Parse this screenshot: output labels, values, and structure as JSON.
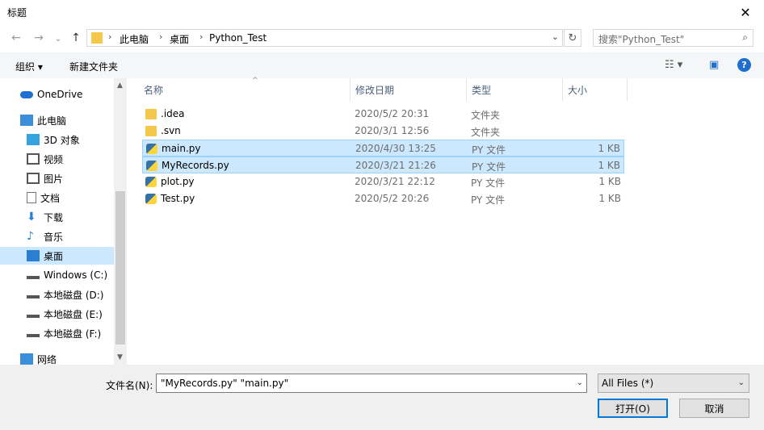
{
  "window": {
    "title": "标题",
    "close_glyph": "✕"
  },
  "nav": {
    "back_glyph": "←",
    "forward_glyph": "→",
    "recent_glyph": "⌄",
    "up_glyph": "↑",
    "breadcrumbs": [
      "此电脑",
      "桌面",
      "Python_Test"
    ],
    "sep_glyph": "›",
    "dropdown_glyph": "⌄",
    "refresh_glyph": "↻",
    "search_placeholder": "搜索\"Python_Test\"",
    "search_glyph": "⌕"
  },
  "toolbar": {
    "organize": "组织 ▾",
    "new_folder": "新建文件夹",
    "view_glyph": "☷ ▾",
    "pane_glyph": "▣",
    "help_glyph": "?"
  },
  "sidebar": {
    "items": [
      {
        "label": "OneDrive",
        "icon": "cloud-icon",
        "color": "#1e6fd0"
      },
      {
        "label": "此电脑",
        "icon": "computer-icon",
        "color": "#3a8fd8"
      },
      {
        "label": "3D 对象",
        "icon": "cube-icon",
        "color": "#35a3e0"
      },
      {
        "label": "视频",
        "icon": "video-icon",
        "color": "#555555"
      },
      {
        "label": "图片",
        "icon": "picture-icon",
        "color": "#555555"
      },
      {
        "label": "文档",
        "icon": "document-icon",
        "color": "#777777"
      },
      {
        "label": "下载",
        "icon": "download-icon",
        "color": "#2a7fd4"
      },
      {
        "label": "音乐",
        "icon": "music-icon",
        "color": "#2a7fd4"
      },
      {
        "label": "桌面",
        "icon": "desktop-icon",
        "color": "#2a7fd4",
        "selected": true
      },
      {
        "label": "Windows (C:)",
        "icon": "drive-icon",
        "color": "#555555"
      },
      {
        "label": "本地磁盘 (D:)",
        "icon": "drive-icon",
        "color": "#555555"
      },
      {
        "label": "本地磁盘 (E:)",
        "icon": "drive-icon",
        "color": "#555555"
      },
      {
        "label": "本地磁盘 (F:)",
        "icon": "drive-icon",
        "color": "#555555"
      },
      {
        "label": "网络",
        "icon": "network-icon",
        "color": "#3a8fd8"
      }
    ],
    "scroll_up": "▲",
    "scroll_down": "▼"
  },
  "list": {
    "columns": {
      "name": "名称",
      "date": "修改日期",
      "type": "类型",
      "size": "大小"
    },
    "sort_glyph": "^",
    "rows": [
      {
        "name": ".idea",
        "date": "2020/5/2 20:31",
        "type": "文件夹",
        "size": "",
        "icon": "folder-icon"
      },
      {
        "name": ".svn",
        "date": "2020/3/1 12:56",
        "type": "文件夹",
        "size": "",
        "icon": "folder-icon"
      },
      {
        "name": "main.py",
        "date": "2020/4/30 13:25",
        "type": "PY 文件",
        "size": "1 KB",
        "icon": "python-file-icon",
        "selected": true
      },
      {
        "name": "MyRecords.py",
        "date": "2020/3/21 21:26",
        "type": "PY 文件",
        "size": "1 KB",
        "icon": "python-file-icon",
        "selected": true
      },
      {
        "name": "plot.py",
        "date": "2020/3/21 22:12",
        "type": "PY 文件",
        "size": "1 KB",
        "icon": "python-file-icon"
      },
      {
        "name": "Test.py",
        "date": "2020/5/2 20:26",
        "type": "PY 文件",
        "size": "1 KB",
        "icon": "python-file-icon"
      }
    ]
  },
  "footer": {
    "filename_label": "文件名(N):",
    "filename_value": "\"MyRecords.py\" \"main.py\"",
    "filetype_value": "All Files  (*)",
    "dropdown_glyph": "⌄",
    "open_label": "打开(O)",
    "cancel_label": "取消"
  }
}
